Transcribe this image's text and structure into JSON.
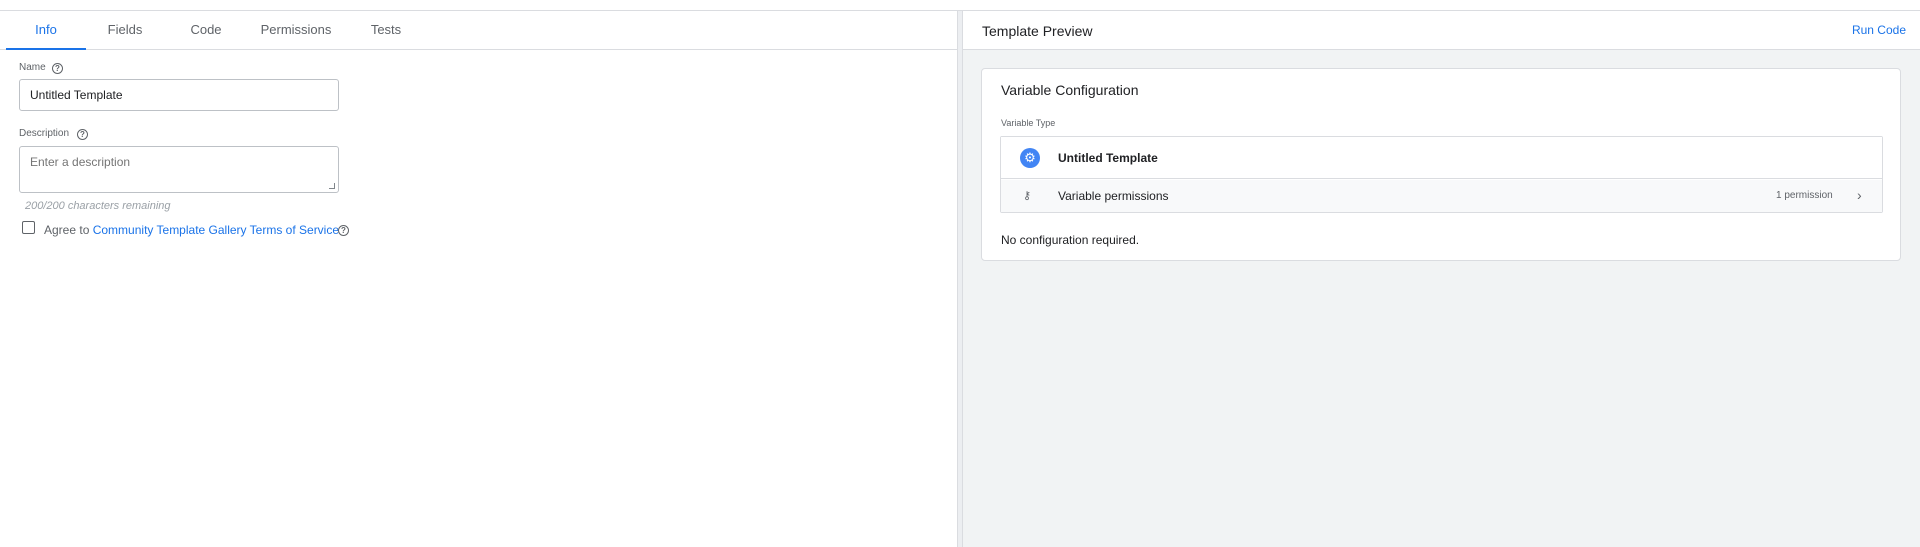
{
  "tabs": [
    {
      "label": "Info",
      "active": true
    },
    {
      "label": "Fields",
      "active": false
    },
    {
      "label": "Code",
      "active": false
    },
    {
      "label": "Permissions",
      "active": false
    },
    {
      "label": "Tests",
      "active": false
    }
  ],
  "form": {
    "name_label": "Name",
    "name_value": "Untitled Template",
    "description_label": "Description",
    "description_placeholder": "Enter a description",
    "chars_remaining": "200/200 characters remaining",
    "agree_prefix": "Agree to",
    "agree_link": "Community Template Gallery Terms of Service",
    "help_glyph": "?"
  },
  "preview": {
    "title": "Template Preview",
    "run_code": "Run Code",
    "card_title": "Variable Configuration",
    "variable_type_label": "Variable Type",
    "template_name": "Untitled Template",
    "permissions_label": "Variable permissions",
    "permissions_count": "1 permission",
    "no_config": "No configuration required."
  },
  "icons": {
    "gear": "gear-icon",
    "key": "key-icon",
    "chevron": "chevron-right-icon",
    "help": "help-circle-icon"
  },
  "colors": {
    "accent": "#1a73e8",
    "gear_bg": "#4285f4",
    "panel_bg": "#f1f3f4"
  }
}
